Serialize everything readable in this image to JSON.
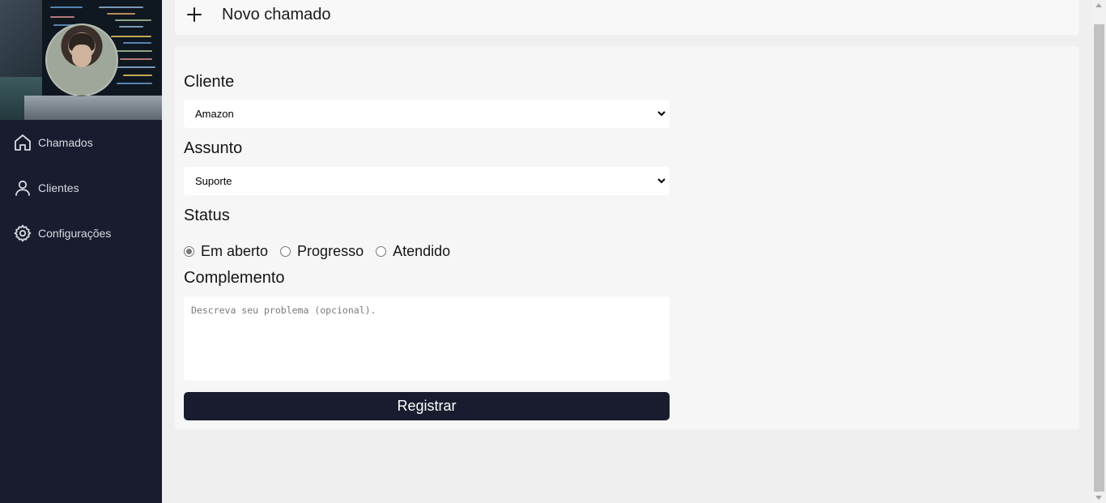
{
  "sidebar": {
    "items": [
      {
        "label": "Chamados",
        "icon": "home-icon"
      },
      {
        "label": "Clientes",
        "icon": "user-icon"
      },
      {
        "label": "Configurações",
        "icon": "gear-icon"
      }
    ]
  },
  "header": {
    "icon": "plus-icon",
    "title": "Novo chamado"
  },
  "form": {
    "cliente_label": "Cliente",
    "cliente_value": "Amazon",
    "assunto_label": "Assunto",
    "assunto_value": "Suporte",
    "status_label": "Status",
    "status_options": [
      "Em aberto",
      "Progresso",
      "Atendido"
    ],
    "status_selected": "Em aberto",
    "complemento_label": "Complemento",
    "complemento_placeholder": "Descreva seu problema (opcional).",
    "submit_label": "Registrar"
  },
  "colors": {
    "sidebar_bg": "#181c2e",
    "page_bg": "#efefef",
    "card_bg": "#f6f6f6",
    "button_bg": "#181c2e"
  }
}
